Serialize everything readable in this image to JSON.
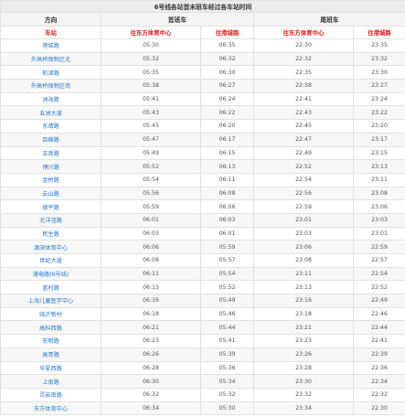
{
  "title": "6号线各站首末班车经过各车站时间",
  "headers": {
    "direction": "方向",
    "first_train": "首班车",
    "last_train": "尾班车",
    "station": "车站",
    "to_oriental_sports_center": "往东方体育中心",
    "to_ganglan_road": "往港城路"
  },
  "rows": [
    {
      "station": "港城路",
      "first_to_east": "05:30",
      "first_to_gangcheng": "06:35",
      "last_to_east": "22:30",
      "last_to_gangcheng": "23:35"
    },
    {
      "station": "外高桥保税区北",
      "first_to_east": "05:32",
      "first_to_gangcheng": "06:32",
      "last_to_east": "22:32",
      "last_to_gangcheng": "23:32"
    },
    {
      "station": "航津路",
      "first_to_east": "05:35",
      "first_to_gangcheng": "06:30",
      "last_to_east": "22:35",
      "last_to_gangcheng": "23:30"
    },
    {
      "station": "外高桥保税区南",
      "first_to_east": "05:38",
      "first_to_gangcheng": "06:27",
      "last_to_east": "22:38",
      "last_to_gangcheng": "23:27"
    },
    {
      "station": "洲海路",
      "first_to_east": "05:41",
      "first_to_gangcheng": "06:24",
      "last_to_east": "22:41",
      "last_to_gangcheng": "23:24"
    },
    {
      "station": "五洲大道",
      "first_to_east": "05:43",
      "first_to_gangcheng": "06:22",
      "last_to_east": "22:43",
      "last_to_gangcheng": "23:22"
    },
    {
      "station": "东靖路",
      "first_to_east": "05:45",
      "first_to_gangcheng": "06:20",
      "last_to_east": "22:45",
      "last_to_gangcheng": "23:20"
    },
    {
      "station": "巨峰路",
      "first_to_east": "05:47",
      "first_to_gangcheng": "06:17",
      "last_to_east": "22:47",
      "last_to_gangcheng": "23:17"
    },
    {
      "station": "五莲路",
      "first_to_east": "05:49",
      "first_to_gangcheng": "06:15",
      "last_to_east": "22:49",
      "last_to_gangcheng": "23:15"
    },
    {
      "station": "博兴路",
      "first_to_east": "05:52",
      "first_to_gangcheng": "06:13",
      "last_to_east": "22:52",
      "last_to_gangcheng": "23:13"
    },
    {
      "station": "金桥路",
      "first_to_east": "05:54",
      "first_to_gangcheng": "06:11",
      "last_to_east": "22:54",
      "last_to_gangcheng": "23:11"
    },
    {
      "station": "云山路",
      "first_to_east": "05:56",
      "first_to_gangcheng": "06:08",
      "last_to_east": "22:56",
      "last_to_gangcheng": "23:08"
    },
    {
      "station": "德平路",
      "first_to_east": "05:59",
      "first_to_gangcheng": "06:06",
      "last_to_east": "22:59",
      "last_to_gangcheng": "23:06"
    },
    {
      "station": "北洋泾路",
      "first_to_east": "06:01",
      "first_to_gangcheng": "06:03",
      "last_to_east": "23:01",
      "last_to_gangcheng": "23:03"
    },
    {
      "station": "民生路",
      "first_to_east": "06:03",
      "first_to_gangcheng": "06:01",
      "last_to_east": "23:03",
      "last_to_gangcheng": "23:01"
    },
    {
      "station": "源深体育中心",
      "first_to_east": "06:06",
      "first_to_gangcheng": "05:59",
      "last_to_east": "23:06",
      "last_to_gangcheng": "22:59"
    },
    {
      "station": "世纪大道",
      "first_to_east": "06:08",
      "first_to_gangcheng": "05:57",
      "last_to_east": "23:08",
      "last_to_gangcheng": "22:57"
    },
    {
      "station": "浦电路(6号线)",
      "first_to_east": "06:11",
      "first_to_gangcheng": "05:54",
      "last_to_east": "23:11",
      "last_to_gangcheng": "22:54"
    },
    {
      "station": "蓝村路",
      "first_to_east": "06:13",
      "first_to_gangcheng": "05:52",
      "last_to_east": "23:13",
      "last_to_gangcheng": "22:52"
    },
    {
      "station": "上海儿童医学中心",
      "first_to_east": "06:16",
      "first_to_gangcheng": "05:49",
      "last_to_east": "23:16",
      "last_to_gangcheng": "22:49"
    },
    {
      "station": "临沂新村",
      "first_to_east": "06:18",
      "first_to_gangcheng": "05:46",
      "last_to_east": "23:18",
      "last_to_gangcheng": "22:46"
    },
    {
      "station": "高科西路",
      "first_to_east": "06:21",
      "first_to_gangcheng": "05:44",
      "last_to_east": "23:21",
      "last_to_gangcheng": "22:44"
    },
    {
      "station": "东明路",
      "first_to_east": "06:23",
      "first_to_gangcheng": "05:41",
      "last_to_east": "23:23",
      "last_to_gangcheng": "22:41"
    },
    {
      "station": "高青路",
      "first_to_east": "06:26",
      "first_to_gangcheng": "05:39",
      "last_to_east": "23:26",
      "last_to_gangcheng": "22:39"
    },
    {
      "station": "华夏西路",
      "first_to_east": "06:28",
      "first_to_gangcheng": "05:36",
      "last_to_east": "23:28",
      "last_to_gangcheng": "22:36"
    },
    {
      "station": "上南路",
      "first_to_east": "06:30",
      "first_to_gangcheng": "05:34",
      "last_to_east": "23:30",
      "last_to_gangcheng": "22:34"
    },
    {
      "station": "灵岩南路",
      "first_to_east": "06:32",
      "first_to_gangcheng": "05:32",
      "last_to_east": "23:32",
      "last_to_gangcheng": "22:32"
    },
    {
      "station": "东方体育中心",
      "first_to_east": "06:34",
      "first_to_gangcheng": "05:30",
      "last_to_east": "23:34",
      "last_to_gangcheng": "22:30"
    }
  ],
  "colors": {
    "header_red": "#e02020",
    "station_blue": "#2b78c9",
    "time_gray": "#555555"
  }
}
